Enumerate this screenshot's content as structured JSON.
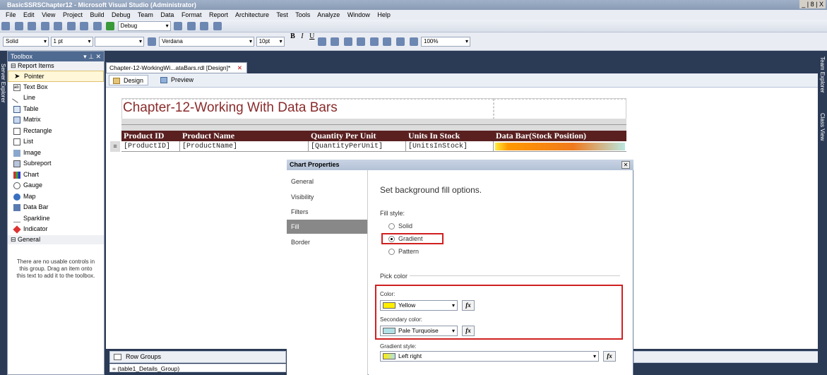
{
  "window": {
    "title": "BasicSSRSChapter12 - Microsoft Visual Studio (Administrator)",
    "controls": "_ | 8 | X"
  },
  "menu": [
    "File",
    "Edit",
    "View",
    "Project",
    "Build",
    "Debug",
    "Team",
    "Data",
    "Format",
    "Report",
    "Architecture",
    "Test",
    "Tools",
    "Analyze",
    "Window",
    "Help"
  ],
  "toolbar": {
    "config": "Debug",
    "line_style": "Solid",
    "line_width": "1 pt",
    "font": "Verdana",
    "font_size": "10pt",
    "zoom": "100%"
  },
  "side": {
    "server_explorer": "Server Explorer",
    "team_explorer": "Team Explorer",
    "class_view": "Class View"
  },
  "toolbox": {
    "title": "Toolbox",
    "group_report": "Report Items",
    "items": [
      "Pointer",
      "Text Box",
      "Line",
      "Table",
      "Matrix",
      "Rectangle",
      "List",
      "Image",
      "Subreport",
      "Chart",
      "Gauge",
      "Map",
      "Data Bar",
      "Sparkline",
      "Indicator"
    ],
    "group_general": "General",
    "empty_message": "There are no usable controls in this group. Drag an item onto this text to add it to the toolbox."
  },
  "document": {
    "tab": "Chapter-12-WorkingWi...ataBars.rdl [Design]*",
    "design_tab": "Design",
    "preview_tab": "Preview"
  },
  "report": {
    "title": "Chapter-12-Working With Data Bars",
    "headers": [
      "Product ID",
      "Product Name",
      "Quantity Per Unit",
      "Units In Stock",
      "Data Bar(Stock Position)"
    ],
    "cells": [
      "[ProductID]",
      "[ProductName]",
      "[QuantityPerUnit]",
      "[UnitsInStock]"
    ]
  },
  "dialog": {
    "title": "Chart Properties",
    "nav": [
      "General",
      "Visibility",
      "Filters",
      "Fill",
      "Border"
    ],
    "active_nav": "Fill",
    "heading": "Set background fill options.",
    "fill_style_label": "Fill style:",
    "fill_options": [
      "Solid",
      "Gradient",
      "Pattern"
    ],
    "selected_fill": "Gradient",
    "pick_color_label": "Pick color",
    "color_label": "Color:",
    "color_value": "Yellow",
    "color_hex": "#ffee00",
    "secondary_label": "Secondary color:",
    "secondary_value": "Pale Turquoise",
    "secondary_hex": "#b0e0e6",
    "gradient_label": "Gradient style:",
    "gradient_value": "Left right",
    "fx": "fx"
  },
  "bottom": {
    "row_groups": "Row Groups",
    "group_entry": "= (table1_Details_Group)"
  }
}
